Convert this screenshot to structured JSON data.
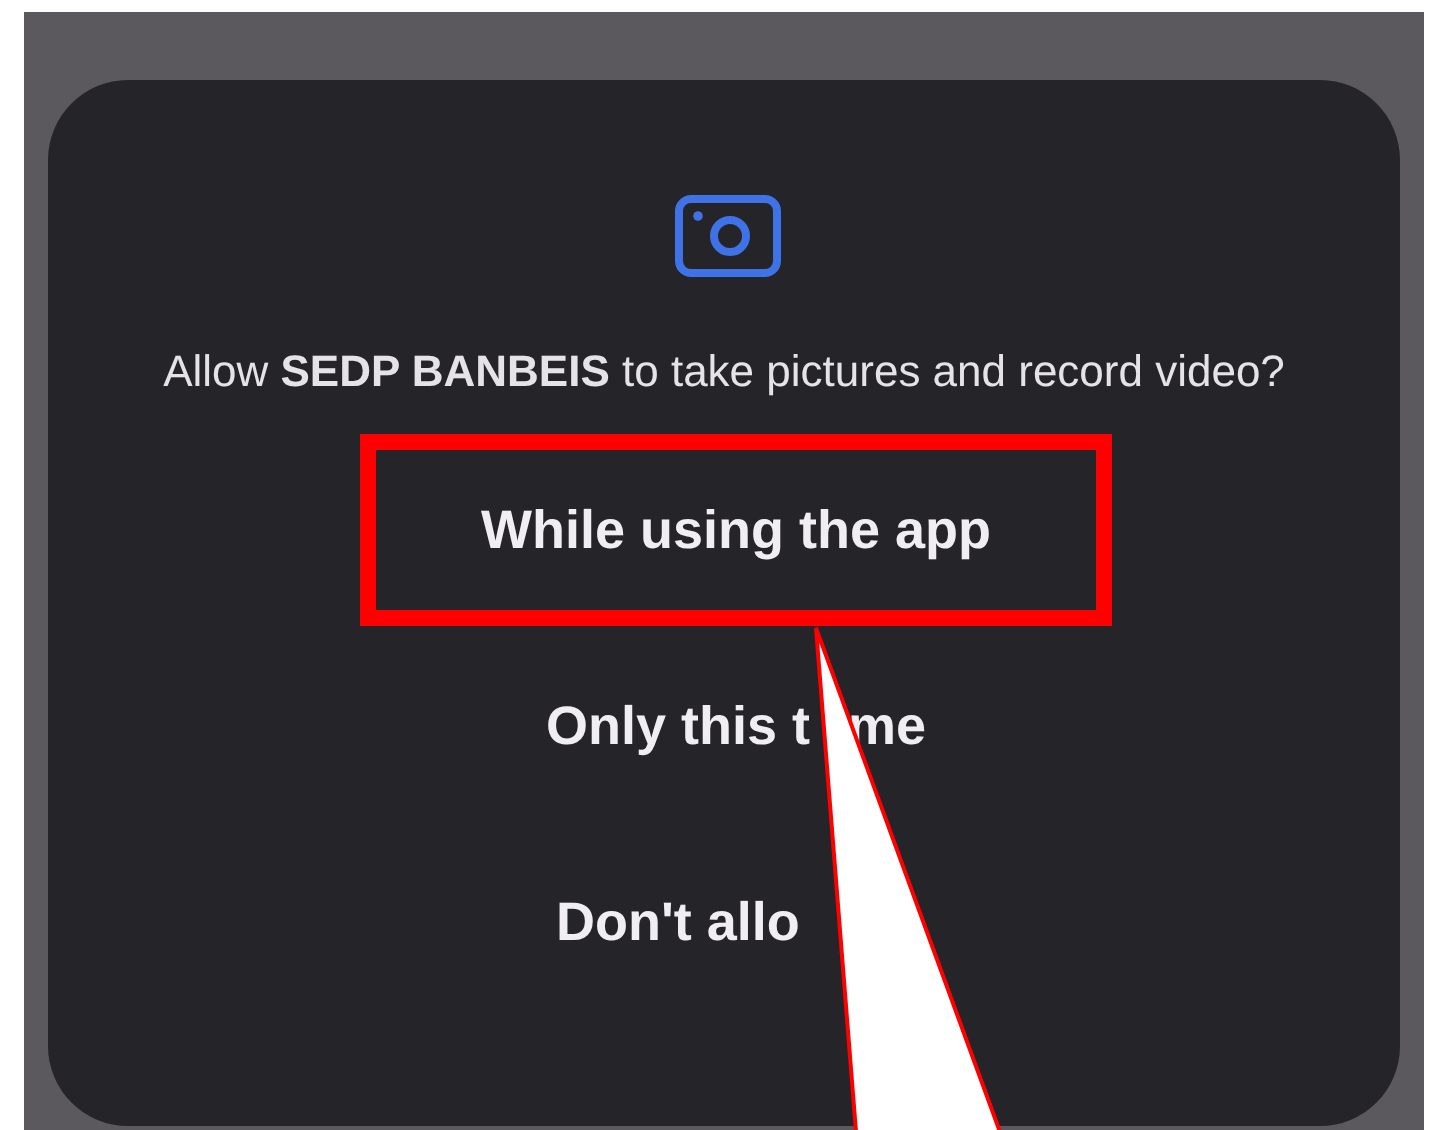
{
  "dialog": {
    "message": "Allow **SEDP BANBEIS** to take pictures and record video?",
    "options": [
      {
        "label_parts": [
          "While using the app"
        ],
        "highlighted": true
      },
      {
        "label_parts": [
          "Only this t",
          "me"
        ],
        "highlighted": false
      },
      {
        "label_parts": [
          "Don't allo"
        ],
        "highlighted": false
      }
    ]
  },
  "annotation": {
    "pointer": true
  }
}
